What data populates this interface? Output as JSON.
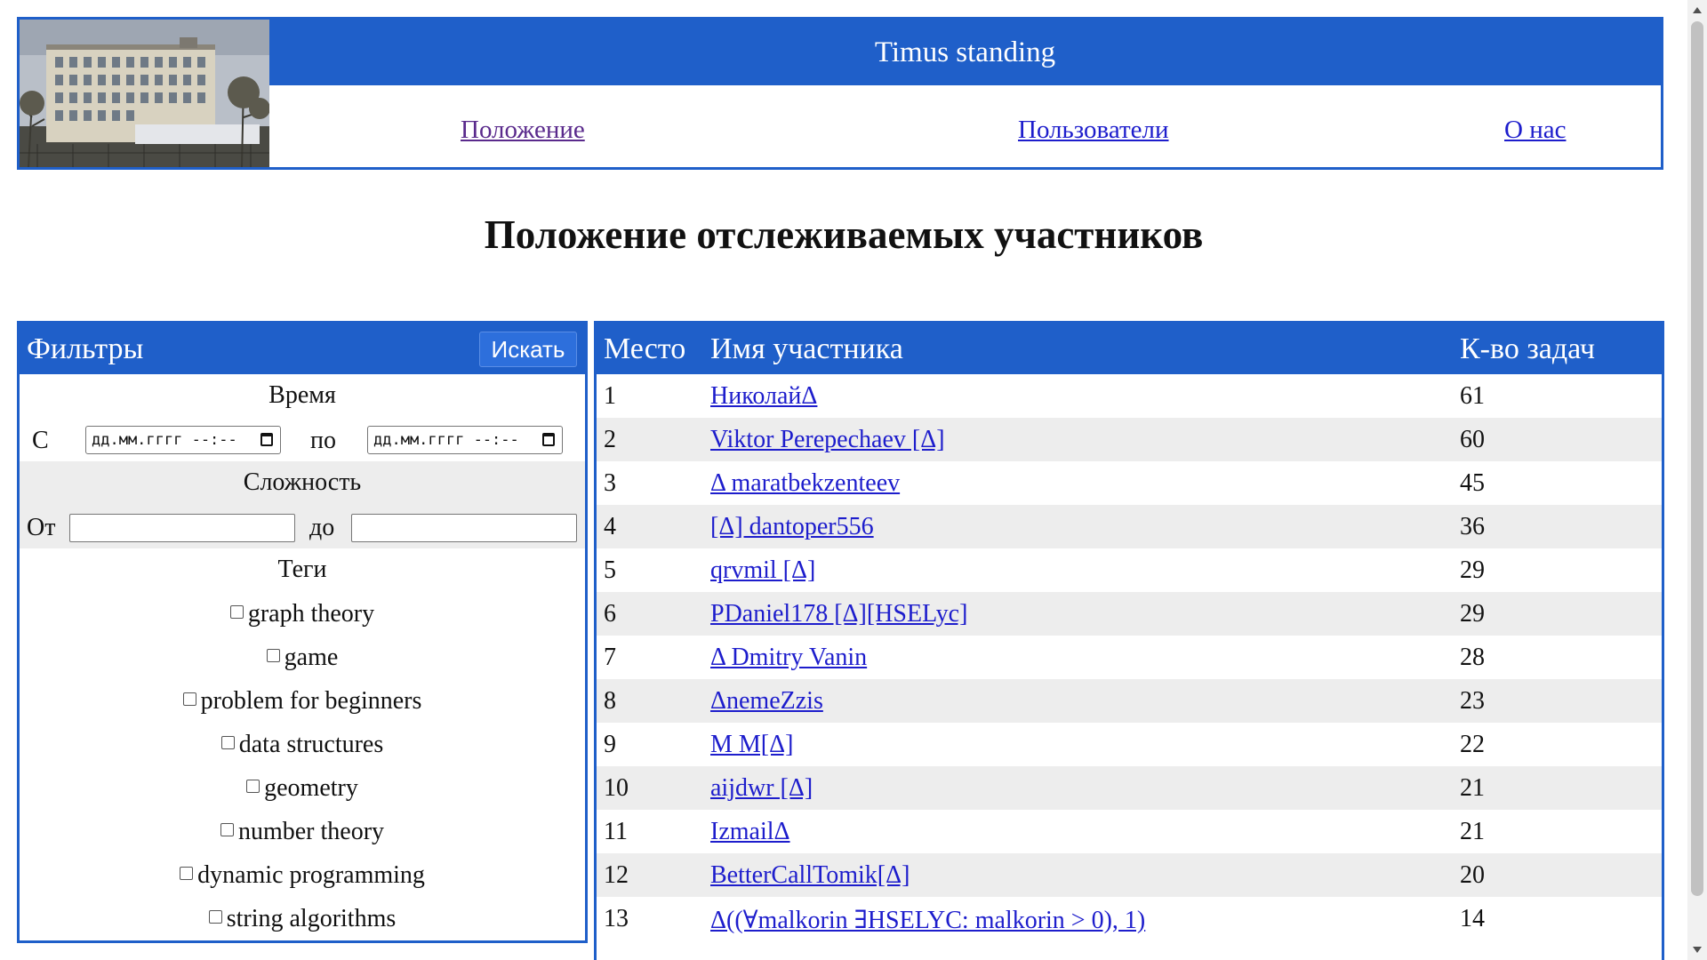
{
  "header": {
    "title": "Timus standing",
    "nav": [
      {
        "label": "Положение"
      },
      {
        "label": "Пользователи"
      },
      {
        "label": "О нас"
      }
    ]
  },
  "page_title": "Положение отслеживаемых участников",
  "filters": {
    "title": "Фильтры",
    "search_button": "Искать",
    "time_heading": "Время",
    "from_label": "С",
    "to_label": "по",
    "date_placeholder": "дд.мм.гггг --:--",
    "difficulty_heading": "Сложность",
    "diff_from_label": "От",
    "diff_to_label": "до",
    "tags_heading": "Теги",
    "tags": [
      {
        "label": "graph theory",
        "checked": false
      },
      {
        "label": "game",
        "checked": false
      },
      {
        "label": "problem for beginners",
        "checked": false
      },
      {
        "label": "data structures",
        "checked": false
      },
      {
        "label": "geometry",
        "checked": false
      },
      {
        "label": "number theory",
        "checked": false
      },
      {
        "label": "dynamic programming",
        "checked": false
      },
      {
        "label": "string algorithms",
        "checked": false
      }
    ]
  },
  "standings": {
    "columns": [
      "Место",
      "Имя участника",
      "К-во задач"
    ],
    "rows": [
      {
        "place": "1",
        "name": "НиколайΔ",
        "solved": "61"
      },
      {
        "place": "2",
        "name": "Viktor Perepechaev [Δ]",
        "solved": "60"
      },
      {
        "place": "3",
        "name": "Δ maratbekzenteev",
        "solved": "45"
      },
      {
        "place": "4",
        "name": "[Δ] dantoper556",
        "solved": "36"
      },
      {
        "place": "5",
        "name": "qrvmil [Δ]",
        "solved": "29"
      },
      {
        "place": "6",
        "name": "PDaniel178 [Δ][HSELyc]",
        "solved": "29"
      },
      {
        "place": "7",
        "name": "Δ Dmitry Vanin",
        "solved": "28"
      },
      {
        "place": "8",
        "name": "ΔnemeZzis",
        "solved": "23"
      },
      {
        "place": "9",
        "name": "M M[Δ]",
        "solved": "22"
      },
      {
        "place": "10",
        "name": "aijdwr [Δ]",
        "solved": "21"
      },
      {
        "place": "11",
        "name": "IzmailΔ",
        "solved": "21"
      },
      {
        "place": "12",
        "name": "BetterCallTomik[Δ]",
        "solved": "20"
      },
      {
        "place": "13",
        "name": "Δ((∀malkorin ∃HSELYC: malkorin > 0), 1)",
        "solved": "14"
      }
    ]
  },
  "colors": {
    "accent": "#1f5fc9",
    "link": "#1d1dcc",
    "visited_link": "#5a2a8c",
    "stripe": "#ededed"
  }
}
